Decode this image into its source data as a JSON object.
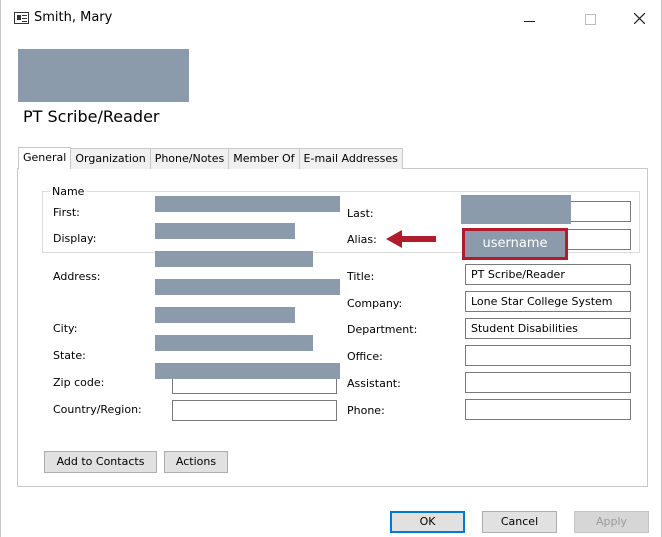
{
  "window": {
    "title": "Smith, Mary"
  },
  "header": {
    "title": "PT Scribe/Reader"
  },
  "tabs": [
    "General",
    "Organization",
    "Phone/Notes",
    "Member Of",
    "E-mail Addresses"
  ],
  "name_group": {
    "legend": "Name",
    "first_label": "First:",
    "display_label": "Display:",
    "last_label": "Last:",
    "alias_label": "Alias:",
    "alias_value": "username"
  },
  "left_fields": {
    "address_label": "Address:",
    "city_label": "City:",
    "state_label": "State:",
    "zip_label": "Zip code:",
    "country_label": "Country/Region:"
  },
  "right_fields": {
    "title_label": "Title:",
    "title_value": "PT Scribe/Reader",
    "company_label": "Company:",
    "company_value": "Lone Star College System",
    "department_label": "Department:",
    "department_value": "Student Disabilities",
    "office_label": "Office:",
    "assistant_label": "Assistant:",
    "phone_label": "Phone:"
  },
  "buttons": {
    "add_to_contacts": "Add to Contacts",
    "actions": "Actions",
    "ok": "OK",
    "cancel": "Cancel",
    "apply": "Apply"
  },
  "colors": {
    "redaction": "#8c9bab",
    "highlight": "#b01c2e",
    "default_button_border": "#0078d7"
  }
}
